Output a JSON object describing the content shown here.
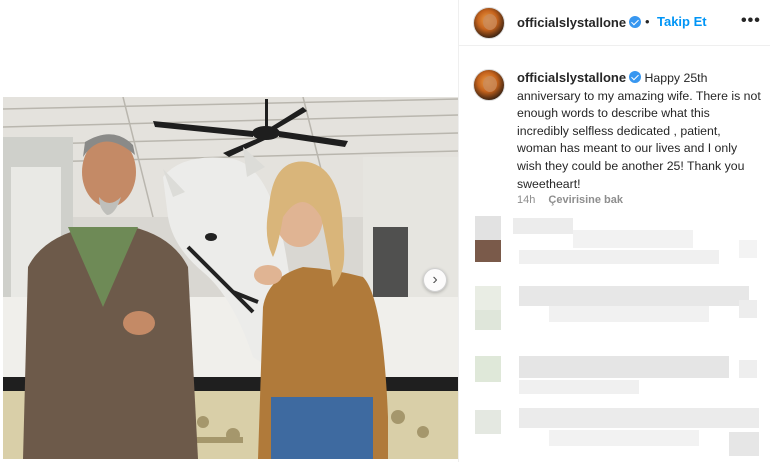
{
  "post": {
    "username": "officialslystallone",
    "follow_label": "Takip Et",
    "dot": "•",
    "more_label": "•••",
    "caption_body": "Happy 25th anniversary to my amazing wife. There is not enough words to describe what this incredibly selfless dedicated , patient, woman has meant to our lives and I only wish they could be another 25! Thank you sweetheart!",
    "timestamp": "14h",
    "translate_label": "Çevirisine bak",
    "next_label": "›"
  },
  "colors": {
    "accent": "#0095f6",
    "verified": "#3897f0",
    "text": "#262626",
    "muted": "#8e8e8e"
  },
  "icons": [
    "verified-badge-icon",
    "more-options-icon",
    "chevron-right-icon"
  ]
}
